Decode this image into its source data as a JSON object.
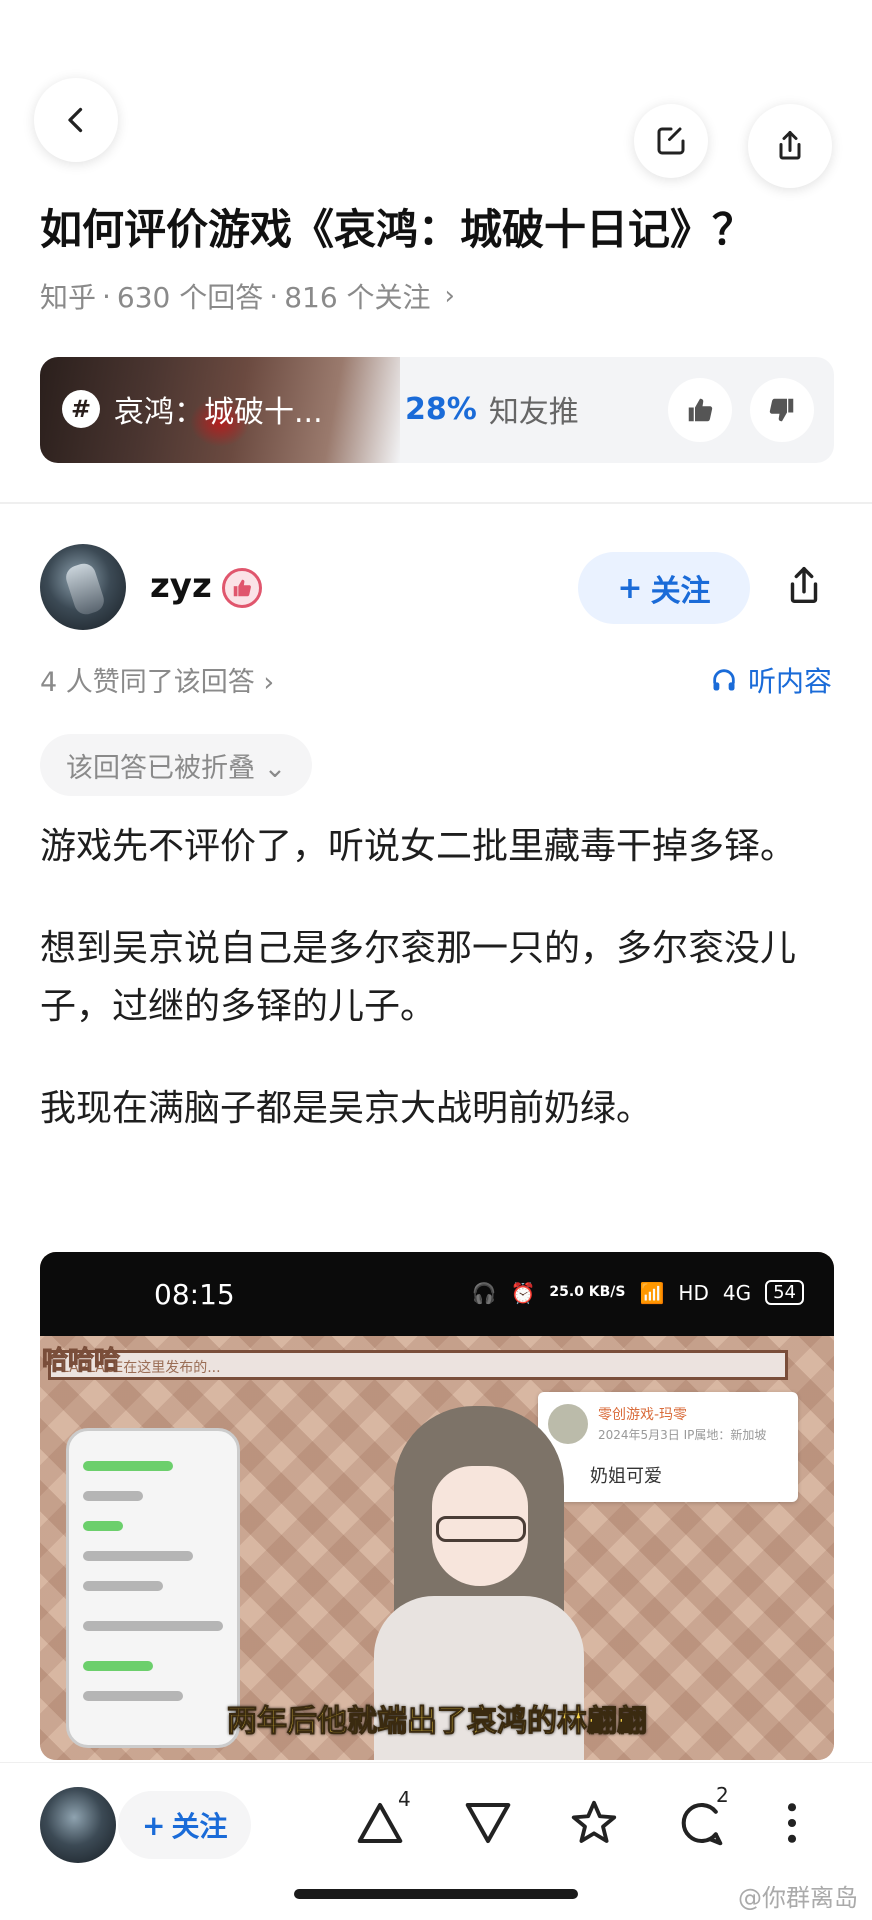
{
  "nav": {
    "back_icon": "back-icon",
    "edit_icon": "edit-icon",
    "share_icon": "share-icon"
  },
  "question": {
    "title": "如何评价游戏《哀鸿：城破十日记》？",
    "source": "知乎",
    "answers": "630 个回答",
    "followers": "816 个关注",
    "dot": "·"
  },
  "topic": {
    "hash": "#",
    "label": "哀鸿：城破十...",
    "percent": "28%",
    "recommend": "知友推"
  },
  "author": {
    "name": "zyz",
    "follow_plus": "+",
    "follow_label": "关注"
  },
  "answer_meta": {
    "agree_text": "4 人赞同了该回答 ›",
    "listen_label": "听内容",
    "folded_label": "该回答已被折叠 ⌄"
  },
  "answer_body": {
    "p1": "游戏先不评价了，听说女二批里藏毒干掉多铎。",
    "p2": "想到吴京说自己是多尔衮那一只的，多尔衮没儿子，过继的多铎的儿子。",
    "p3": "我现在满脑子都是吴京大战明前奶绿。"
  },
  "video": {
    "time": "08:15",
    "speed": "25.0 KB/S",
    "battery": "54",
    "network": "4G",
    "hd": "HD",
    "haha": "哈哈哈",
    "banner": "LAPLACE在这里发布的...",
    "comment_user": "零创游戏-玛零",
    "comment_date": "2024年5月3日 IP属地：新加坡",
    "comment_text": "奶姐可爱",
    "subtitle": "两年后他就端出了哀鸿的林翩翩"
  },
  "bottom": {
    "follow_plus": "+",
    "follow_label": "关注",
    "upvote_count": "4",
    "comment_count": "2",
    "watermark": "@你群离岛"
  },
  "colors": {
    "accent": "#1a6bd8",
    "text": "#1e1e1e",
    "muted": "#8a8a8a"
  }
}
